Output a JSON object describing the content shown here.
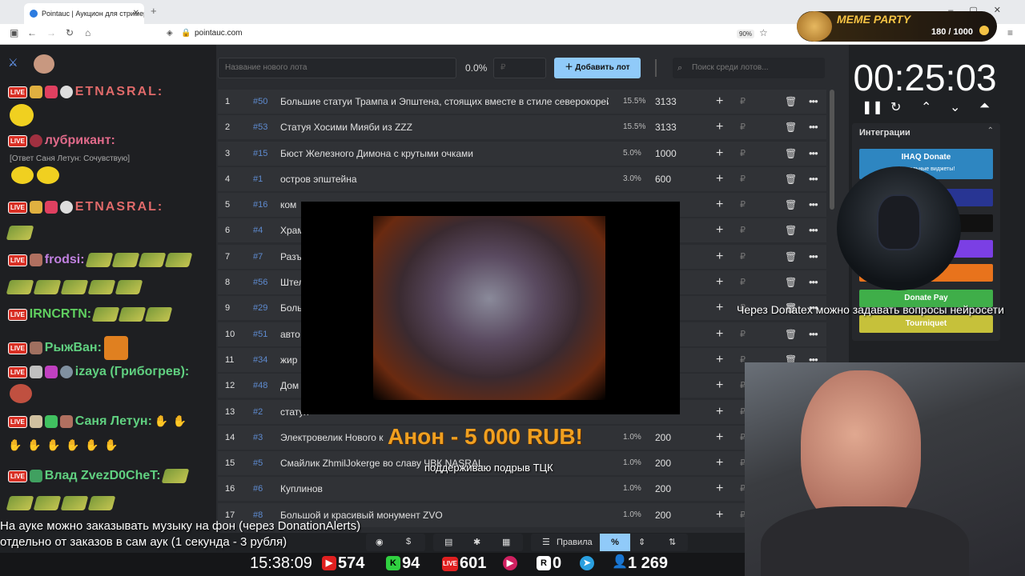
{
  "browser": {
    "tab_title": "Pointauc | Аукцион для стримеров",
    "tab_close": "✕",
    "new_tab": "+",
    "url": "pointauc.com",
    "zoom": "90%"
  },
  "app": {
    "lot_name_placeholder": "Название нового лота",
    "percent": "0.0%",
    "amount_placeholder": "₽",
    "add_lot_label": "Добавить лот",
    "search_placeholder": "Поиск среди лотов...",
    "lots": [
      {
        "n": "1",
        "id": "50",
        "name": "Большие статуи Трампа и Эпштена, стоящих вместе в стиле северокорейских",
        "pct": "15.5%",
        "amount": "3133"
      },
      {
        "n": "2",
        "id": "53",
        "name": "Статуя Хосими Мияби из ZZZ",
        "pct": "15.5%",
        "amount": "3133"
      },
      {
        "n": "3",
        "id": "15",
        "name": "Бюст Железного Димона с крутыми очками",
        "pct": "5.0%",
        "amount": "1000"
      },
      {
        "n": "4",
        "id": "1",
        "name": "остров эпштейна",
        "pct": "3.0%",
        "amount": "600"
      },
      {
        "n": "5",
        "id": "16",
        "name": "ком",
        "pct": "",
        "amount": ""
      },
      {
        "n": "6",
        "id": "4",
        "name": "Храм",
        "pct": "",
        "amount": ""
      },
      {
        "n": "7",
        "id": "7",
        "name": "Разъ",
        "pct": "",
        "amount": ""
      },
      {
        "n": "8",
        "id": "56",
        "name": "Штел",
        "pct": "",
        "amount": ""
      },
      {
        "n": "9",
        "id": "29",
        "name": "Боль",
        "pct": "",
        "amount": ""
      },
      {
        "n": "10",
        "id": "51",
        "name": "авто",
        "pct": "",
        "amount": ""
      },
      {
        "n": "11",
        "id": "34",
        "name": "жир",
        "pct": "",
        "amount": ""
      },
      {
        "n": "12",
        "id": "48",
        "name": "Дом",
        "pct": "",
        "amount": ""
      },
      {
        "n": "13",
        "id": "2",
        "name": "статуя",
        "pct": "",
        "amount": ""
      },
      {
        "n": "14",
        "id": "3",
        "name": "Электровелик Нового к",
        "pct": "1.0%",
        "amount": "200"
      },
      {
        "n": "15",
        "id": "5",
        "name": "Смайлик ZhmilJokerge во славу ЧВК NASRAL",
        "pct": "1.0%",
        "amount": "200"
      },
      {
        "n": "16",
        "id": "6",
        "name": "Куплинов",
        "pct": "1.0%",
        "amount": "200"
      },
      {
        "n": "17",
        "id": "8",
        "name": "Большой и красивый монумент ZVO",
        "pct": "1.0%",
        "amount": "200"
      }
    ]
  },
  "timer": {
    "value": "00:25:03"
  },
  "integrations": {
    "title": "Интеграции",
    "buttons": [
      {
        "label": "IHAQ Donate",
        "sub": "Уникальные виджеты!",
        "color": "#2e86c1"
      },
      {
        "label": "er",
        "sub": "",
        "color": "#283593"
      },
      {
        "label": "",
        "sub": "",
        "color": "#111111"
      },
      {
        "label": "",
        "sub": "",
        "color": "#7b3fe4"
      },
      {
        "label": "lerts",
        "sub": "",
        "color": "#e8731c"
      },
      {
        "label": "Donate Pay",
        "sub": "",
        "color": "#3fae49"
      },
      {
        "label": "Tourniquet",
        "sub": "",
        "color": "#c6c13a"
      }
    ]
  },
  "meme_party": {
    "title": "MEME PARTY",
    "progress": "180 / 1000"
  },
  "chat": {
    "users": [
      {
        "name": "ETNASRAL:",
        "color": "#e06a6a"
      },
      {
        "name": "лубрикант:",
        "color": "#e06a8a"
      },
      {
        "reply": "[Ответ Саня Летун: Сочувствую]"
      },
      {
        "name": "ETNASRAL:",
        "color": "#e06a6a"
      },
      {
        "name": "frodsi:",
        "color": "#c080e0"
      },
      {
        "name": "IRNCRTN:",
        "color": "#60d060"
      },
      {
        "name": "РыжВан:",
        "color": "#60d080"
      },
      {
        "name": "izaya (Грибогрев):",
        "color": "#60d080"
      },
      {
        "name": "Саня Летун:",
        "color": "#60d080"
      },
      {
        "name": "Влад ZvezD0CheT:",
        "color": "#60d080"
      }
    ]
  },
  "overlay": {
    "donation_title": "Анон - 5 000 RUB!",
    "donation_message": "поддерживаю подрыв ТЦК",
    "ticker": "Через Donatex можно задавать вопросы нейросети",
    "notice_line1": "На ауке можно заказывать музыку на фон (через DonationAlerts)",
    "notice_line2": "отдельно от заказов в сам аук (1 секунда - 3 рубля)"
  },
  "bottom_bar": {
    "rules_label": "Правила",
    "percent_symbol": "%"
  },
  "stats": {
    "time": "15:38:09",
    "youtube": "574",
    "kick": "94",
    "live": "601",
    "rutube_icon": "▶",
    "r": "0",
    "users": "1 269"
  }
}
